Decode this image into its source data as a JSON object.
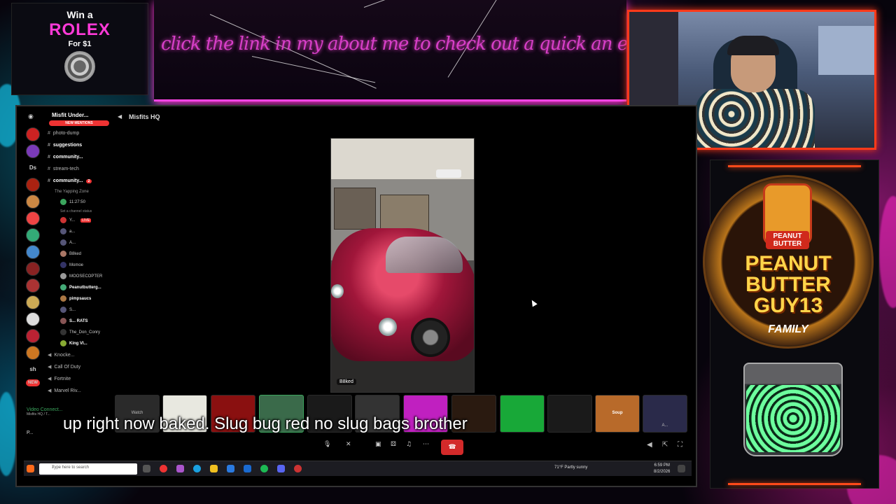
{
  "promo": {
    "win_text": "Win a",
    "brand": "ROLEX",
    "price_text": "For $1",
    "banner_text": "click the link in my about me to check out a quick an easy come up!"
  },
  "discord": {
    "window_title": "Misfits HQ",
    "server_name": "Misfit Under...",
    "new_mentions": "NEW MENTIONS",
    "server_ds": "Ds",
    "server_sh": "sh",
    "server_new": "NEW",
    "channels": [
      {
        "label": "photo-dump",
        "bold": false,
        "badge": ""
      },
      {
        "label": "suggestions",
        "bold": true,
        "badge": ""
      },
      {
        "label": "community...",
        "bold": true,
        "badge": ""
      },
      {
        "label": "stream-tech",
        "bold": false,
        "badge": ""
      },
      {
        "label": "community...",
        "bold": true,
        "badge": "2"
      }
    ],
    "voice_category": "The Yapping Zone",
    "voice_channel_time": "11:27:50",
    "voice_channel_status": "Set a channel status",
    "voice_users": [
      {
        "name": "Y...",
        "bold": false,
        "live": true
      },
      {
        "name": "a...",
        "bold": false,
        "live": false
      },
      {
        "name": "A...",
        "bold": false,
        "live": false
      },
      {
        "name": "B8ked",
        "bold": false,
        "live": false
      },
      {
        "name": "Momoe",
        "bold": false,
        "live": false
      },
      {
        "name": "MOOSECOPTER",
        "bold": false,
        "live": false
      },
      {
        "name": "Peanutbutterg...",
        "bold": true,
        "live": false
      },
      {
        "name": "pimpsaucs",
        "bold": true,
        "live": false
      },
      {
        "name": "S...",
        "bold": false,
        "live": false
      },
      {
        "name": "S... RATS",
        "bold": true,
        "live": false
      },
      {
        "name": "The_Don_Conry",
        "bold": false,
        "live": false
      },
      {
        "name": "King VI...",
        "bold": true,
        "live": false
      }
    ],
    "live_label": "LIVE",
    "other_voice": [
      {
        "label": "Knocke..."
      },
      {
        "label": "Call Of Duty"
      },
      {
        "label": "Fortnite"
      },
      {
        "label": "Marvel Riv..."
      }
    ],
    "video_connected": "Video Connect...",
    "video_connected_sub": "Misfits HQ / T...",
    "user_short": "P...",
    "stream_user_tag": "B8ked",
    "watch_label": "Watch",
    "thumb_label_soup": "Soup",
    "thumb_label_a": "A..."
  },
  "taskbar": {
    "search_placeholder": "Type here to search",
    "weather": "71°F  Partly sunny",
    "time": "6:59 PM",
    "date": "8/2/2026"
  },
  "logo": {
    "jar_label": "PEANUT BUTTER",
    "title_line1": "PEANUT",
    "title_line2": "BUTTER",
    "title_line3": "GUY13",
    "family": "FAMILY"
  },
  "caption": "up right now baked. Slug bug red no slug bags brother",
  "colors": {
    "accent_pink": "#ff3ad8",
    "cam_border": "#ff3a1a",
    "discord_green": "#3ba55d",
    "hangup_red": "#d32a2a"
  }
}
